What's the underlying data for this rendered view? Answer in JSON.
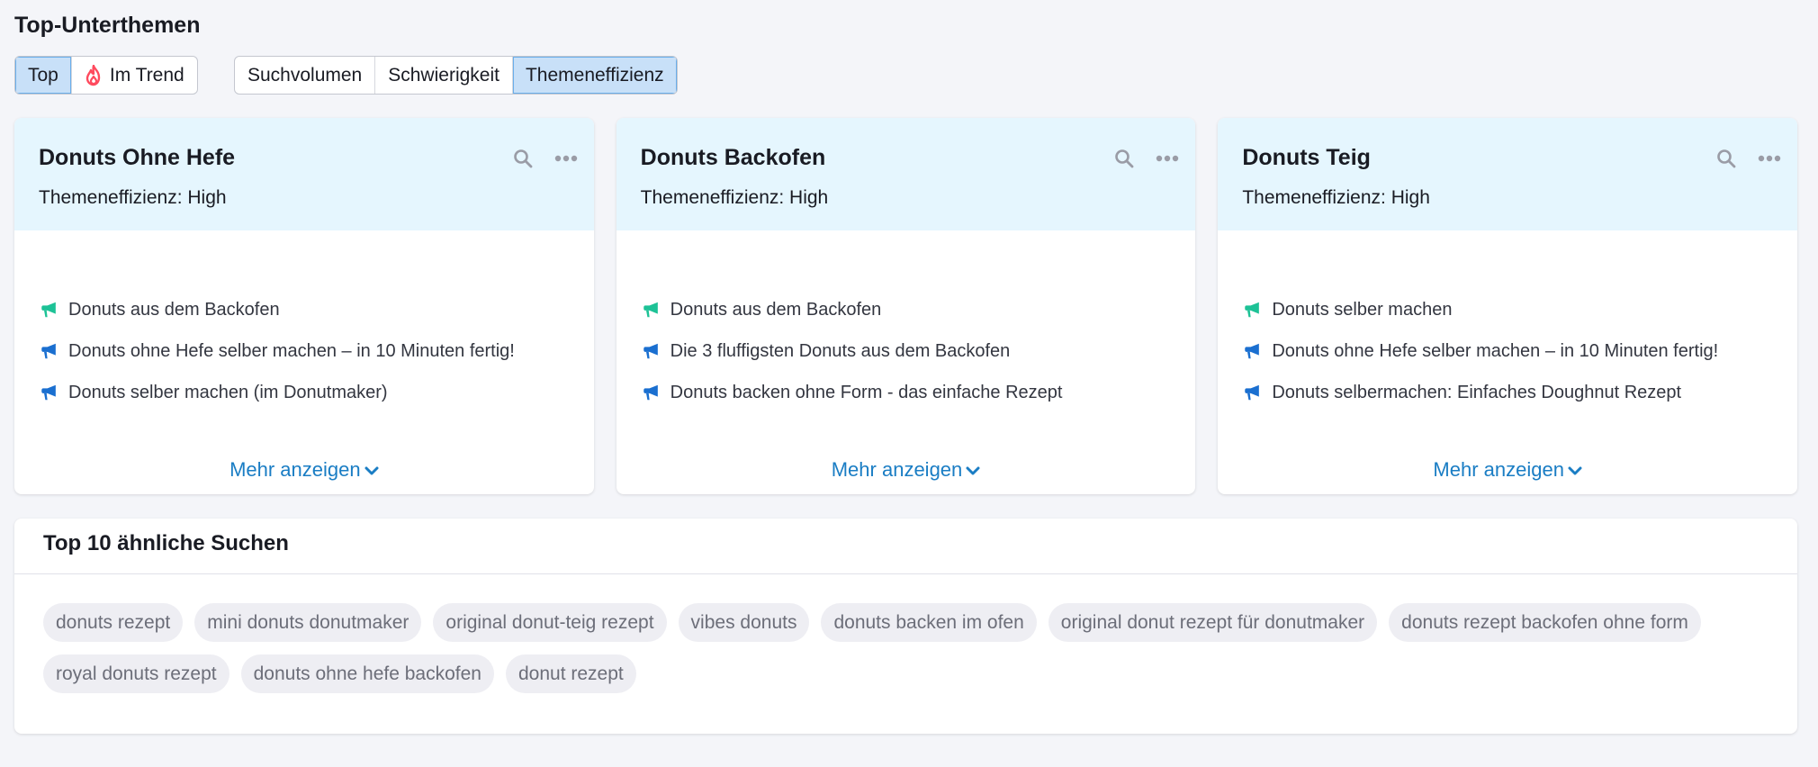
{
  "page": {
    "title": "Top-Unterthemen"
  },
  "view_toggle": [
    {
      "label": "Top",
      "active": true,
      "icon": null
    },
    {
      "label": "Im Trend",
      "active": false,
      "icon": "flame-icon"
    }
  ],
  "sort_toggle": [
    {
      "label": "Suchvolumen",
      "active": false
    },
    {
      "label": "Schwierigkeit",
      "active": false
    },
    {
      "label": "Themeneffizienz",
      "active": true
    }
  ],
  "colors": {
    "accent_link": "#1a7dc4",
    "header_bg": "#e5f6fe",
    "active_toggle": "#c8e0f8",
    "megaphone_green": "#1dc296",
    "megaphone_blue": "#1a6fd0",
    "flame_red": "#ff4a5e"
  },
  "cards": [
    {
      "title": "Donuts Ohne Hefe",
      "subtitle": "Themeneffizienz: High",
      "items": [
        {
          "text": "Donuts aus dem Backofen",
          "icon": "megaphone-green-icon"
        },
        {
          "text": "Donuts ohne Hefe selber machen – in 10 Minuten fertig!",
          "icon": "megaphone-blue-icon"
        },
        {
          "text": "Donuts selber machen (im Donutmaker)",
          "icon": "megaphone-blue-icon"
        }
      ],
      "more_label": "Mehr anzeigen"
    },
    {
      "title": "Donuts Backofen",
      "subtitle": "Themeneffizienz: High",
      "items": [
        {
          "text": "Donuts aus dem Backofen",
          "icon": "megaphone-green-icon"
        },
        {
          "text": "Die 3 fluffigsten Donuts aus dem Backofen",
          "icon": "megaphone-blue-icon"
        },
        {
          "text": "Donuts backen ohne Form - das einfache Rezept",
          "icon": "megaphone-blue-icon"
        }
      ],
      "more_label": "Mehr anzeigen"
    },
    {
      "title": "Donuts Teig",
      "subtitle": "Themeneffizienz: High",
      "items": [
        {
          "text": "Donuts selber machen",
          "icon": "megaphone-green-icon"
        },
        {
          "text": "Donuts ohne Hefe selber machen – in 10 Minuten fertig!",
          "icon": "megaphone-blue-icon"
        },
        {
          "text": "Donuts selbermachen: Einfaches Doughnut Rezept",
          "icon": "megaphone-blue-icon"
        }
      ],
      "more_label": "Mehr anzeigen"
    }
  ],
  "similar": {
    "title": "Top 10 ähnliche Suchen",
    "chips": [
      "donuts rezept",
      "mini donuts donutmaker",
      "original donut-teig rezept",
      "vibes donuts",
      "donuts backen im ofen",
      "original donut rezept für donutmaker",
      "donuts rezept backofen ohne form",
      "royal donuts rezept",
      "donuts ohne hefe backofen",
      "donut rezept"
    ]
  }
}
